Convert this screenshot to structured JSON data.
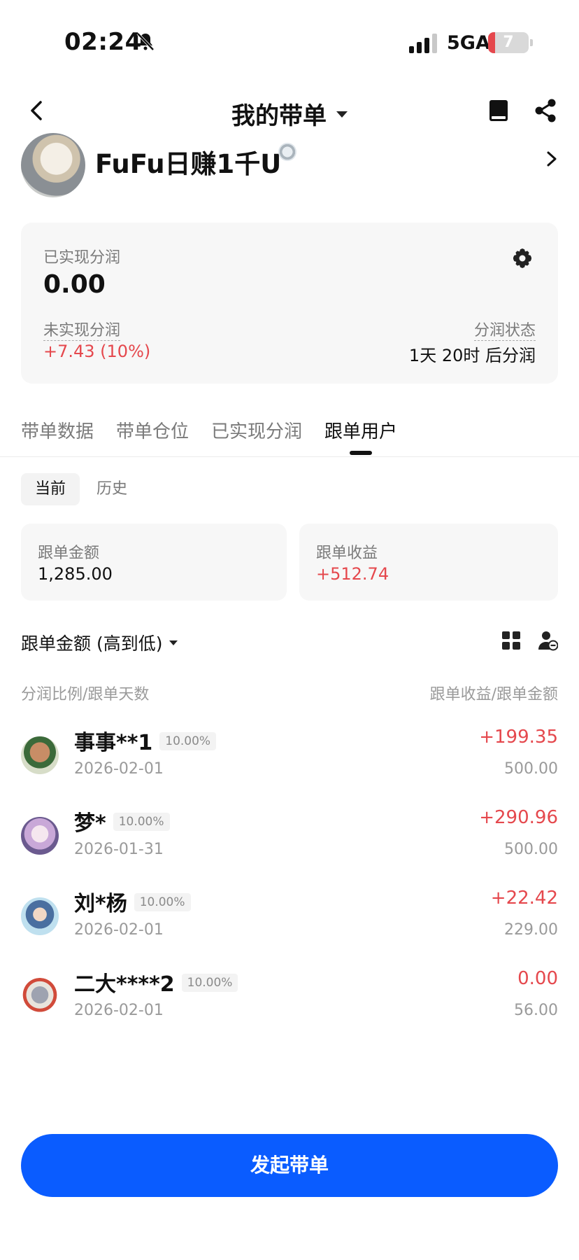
{
  "status_bar": {
    "time": "02:24",
    "network": "5GA",
    "battery": "7"
  },
  "nav": {
    "title": "我的带单"
  },
  "profile": {
    "name": "FuFu日赚1千U"
  },
  "profit_card": {
    "realized_label": "已实现分润",
    "realized_value": "0.00",
    "unrealized_label": "未实现分润",
    "unrealized_value": "+7.43 (10%)",
    "status_label": "分润状态",
    "status_value": "1天 20时 后分润"
  },
  "tabs": [
    {
      "label": "带单数据",
      "active": false
    },
    {
      "label": "带单仓位",
      "active": false
    },
    {
      "label": "已实现分润",
      "active": false
    },
    {
      "label": "跟单用户",
      "active": true
    }
  ],
  "subtabs": {
    "current": "当前",
    "history": "历史"
  },
  "stats": {
    "follow_amount_label": "跟单金额",
    "follow_amount_value": "1,285.00",
    "follow_profit_label": "跟单收益",
    "follow_profit_value": "+512.74"
  },
  "sort": {
    "label": "跟单金额 (高到低)"
  },
  "columns": {
    "left": "分润比例/跟单天数",
    "right": "跟单收益/跟单金额"
  },
  "followers": [
    {
      "name": "事事**1",
      "ratio": "10.00%",
      "date": "2026-02-01",
      "profit": "+199.35",
      "amount": "500.00"
    },
    {
      "name": "梦*",
      "ratio": "10.00%",
      "date": "2026-01-31",
      "profit": "+290.96",
      "amount": "500.00"
    },
    {
      "name": "刘*杨",
      "ratio": "10.00%",
      "date": "2026-02-01",
      "profit": "+22.42",
      "amount": "229.00"
    },
    {
      "name": "二大****2",
      "ratio": "10.00%",
      "date": "2026-02-01",
      "profit": "0.00",
      "amount": "56.00"
    }
  ],
  "bottom_button": {
    "label": "发起带单"
  },
  "colors": {
    "accent": "#0a5cff",
    "profit_red": "#e5484d",
    "muted": "#7a7a7a"
  }
}
